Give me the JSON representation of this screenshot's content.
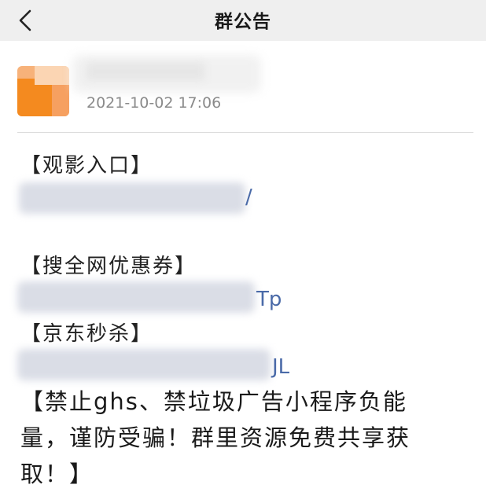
{
  "header": {
    "title": "群公告",
    "back_icon": "chevron-left-icon"
  },
  "post": {
    "timestamp": "2021-10-02 17:06",
    "sections": [
      {
        "heading": "【观影入口】",
        "link_tail": "/"
      },
      {
        "heading": "【搜全网优惠券】",
        "link_tail": "Tp"
      },
      {
        "heading": "【京东秒杀】",
        "link_tail": "JL"
      }
    ],
    "notice_line1": "【禁止ghs、禁垃圾广告小程序负能",
    "notice_line2": "量，谨防受骗！群里资源免费共享获",
    "notice_line3": "取！】"
  },
  "colors": {
    "nav_bg": "#efefef",
    "link": "#4a6aa8",
    "avatar_accent": "#f48a1f"
  }
}
